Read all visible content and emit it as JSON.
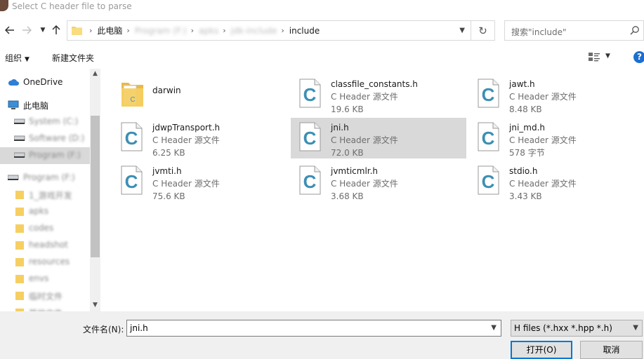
{
  "window": {
    "title": "Select C header file to parse"
  },
  "address_bar": {
    "crumbs": [
      {
        "label": "此电脑",
        "blurred": false
      },
      {
        "label": "Program (F:)",
        "blurred": true
      },
      {
        "label": "apks",
        "blurred": true
      },
      {
        "label": "jdk-include",
        "blurred": true
      },
      {
        "label": "include",
        "blurred": false
      }
    ]
  },
  "search": {
    "placeholder": "搜索\"include\""
  },
  "toolbar": {
    "organize_label": "组织",
    "new_folder_label": "新建文件夹"
  },
  "nav_pane": {
    "items": [
      {
        "label": "OneDrive",
        "icon": "cloud-icon",
        "blurred": false,
        "selected": false
      },
      {
        "label": "此电脑",
        "icon": "computer-icon",
        "blurred": false,
        "selected": false
      },
      {
        "label": "System (C:)",
        "icon": "drive-icon",
        "blurred": true,
        "selected": false
      },
      {
        "label": "Software (D:)",
        "icon": "drive-icon",
        "blurred": true,
        "selected": false
      },
      {
        "label": "Program (F:)",
        "icon": "drive-icon",
        "blurred": true,
        "selected": true
      },
      {
        "label": "Program (F:)",
        "icon": "drive-icon",
        "blurred": true,
        "selected": false
      },
      {
        "label": "1_游戏开发",
        "icon": "folder-icon",
        "blurred": true,
        "selected": false
      },
      {
        "label": "apks",
        "icon": "folder-icon",
        "blurred": true,
        "selected": false
      },
      {
        "label": "codes",
        "icon": "folder-icon",
        "blurred": true,
        "selected": false
      },
      {
        "label": "headshot",
        "icon": "folder-icon",
        "blurred": true,
        "selected": false
      },
      {
        "label": "resources",
        "icon": "folder-icon",
        "blurred": true,
        "selected": false
      },
      {
        "label": "envs",
        "icon": "folder-icon",
        "blurred": true,
        "selected": false
      },
      {
        "label": "临时文件",
        "icon": "folder-icon",
        "blurred": true,
        "selected": false
      },
      {
        "label": "其他文件",
        "icon": "folder-icon",
        "blurred": true,
        "selected": false
      }
    ]
  },
  "files": [
    {
      "name": "darwin",
      "type": "",
      "size": "",
      "icon": "folder-icon",
      "selected": false
    },
    {
      "name": "classfile_constants.h",
      "type": "C Header 源文件",
      "size": "19.6 KB",
      "icon": "c-header-file-icon",
      "selected": false
    },
    {
      "name": "jawt.h",
      "type": "C Header 源文件",
      "size": "8.48 KB",
      "icon": "c-header-file-icon",
      "selected": false
    },
    {
      "name": "jdwpTransport.h",
      "type": "C Header 源文件",
      "size": "6.25 KB",
      "icon": "c-header-file-icon",
      "selected": false
    },
    {
      "name": "jni.h",
      "type": "C Header 源文件",
      "size": "72.0 KB",
      "icon": "c-header-file-icon",
      "selected": true
    },
    {
      "name": "jni_md.h",
      "type": "C Header 源文件",
      "size": "578 字节",
      "icon": "c-header-file-icon",
      "selected": false
    },
    {
      "name": "jvmti.h",
      "type": "C Header 源文件",
      "size": "75.6 KB",
      "icon": "c-header-file-icon",
      "selected": false
    },
    {
      "name": "jvmticmlr.h",
      "type": "C Header 源文件",
      "size": "3.68 KB",
      "icon": "c-header-file-icon",
      "selected": false
    },
    {
      "name": "stdio.h",
      "type": "C Header 源文件",
      "size": "3.43 KB",
      "icon": "c-header-file-icon",
      "selected": false
    }
  ],
  "footer": {
    "filename_label": "文件名(N):",
    "filename_value": "jni.h",
    "filetype_value": "H files (*.hxx *.hpp *.h)",
    "open_label": "打开(O)",
    "cancel_label": "取消"
  },
  "colors": {
    "accent": "#0078d7",
    "selection": "#d9d9d9",
    "c_icon": "#3d8fb3",
    "folder": "#f6cf63"
  }
}
